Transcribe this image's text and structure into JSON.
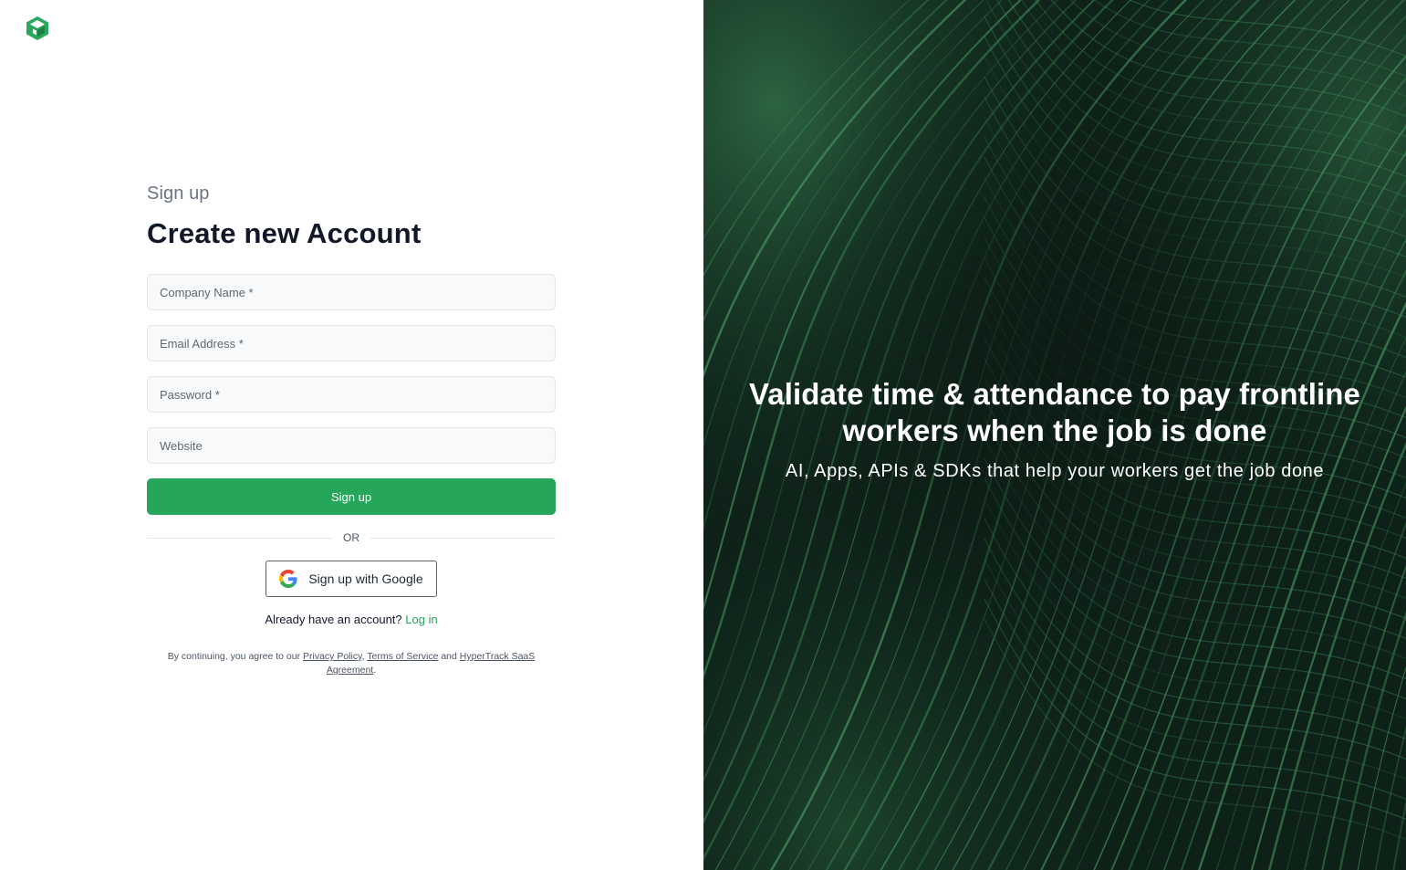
{
  "brand": {
    "logo_icon": "hypertrack-cube-logo",
    "accent_color": "#26a65b"
  },
  "form": {
    "eyebrow": "Sign up",
    "title": "Create new Account",
    "fields": {
      "company_placeholder": "Company Name *",
      "email_placeholder": "Email Address *",
      "password_placeholder": "Password *",
      "website_placeholder": "Website"
    },
    "submit_label": "Sign up",
    "divider_text": "OR",
    "google_label": "Sign up with Google",
    "already_text": "Already have an account?",
    "login_link": "Log in",
    "legal": {
      "prefix": "By continuing, you agree to our",
      "privacy": "Privacy Policy",
      "comma": ",",
      "terms": "Terms of Service",
      "and": "and",
      "saas": "HyperTrack SaaS Agreement",
      "period": "."
    }
  },
  "hero": {
    "title": "Validate time & attendance to pay frontline workers when the job is done",
    "subtitle": "AI, Apps, APIs & SDKs that help your workers get the job done",
    "background": "dark-green-wave-lines"
  }
}
